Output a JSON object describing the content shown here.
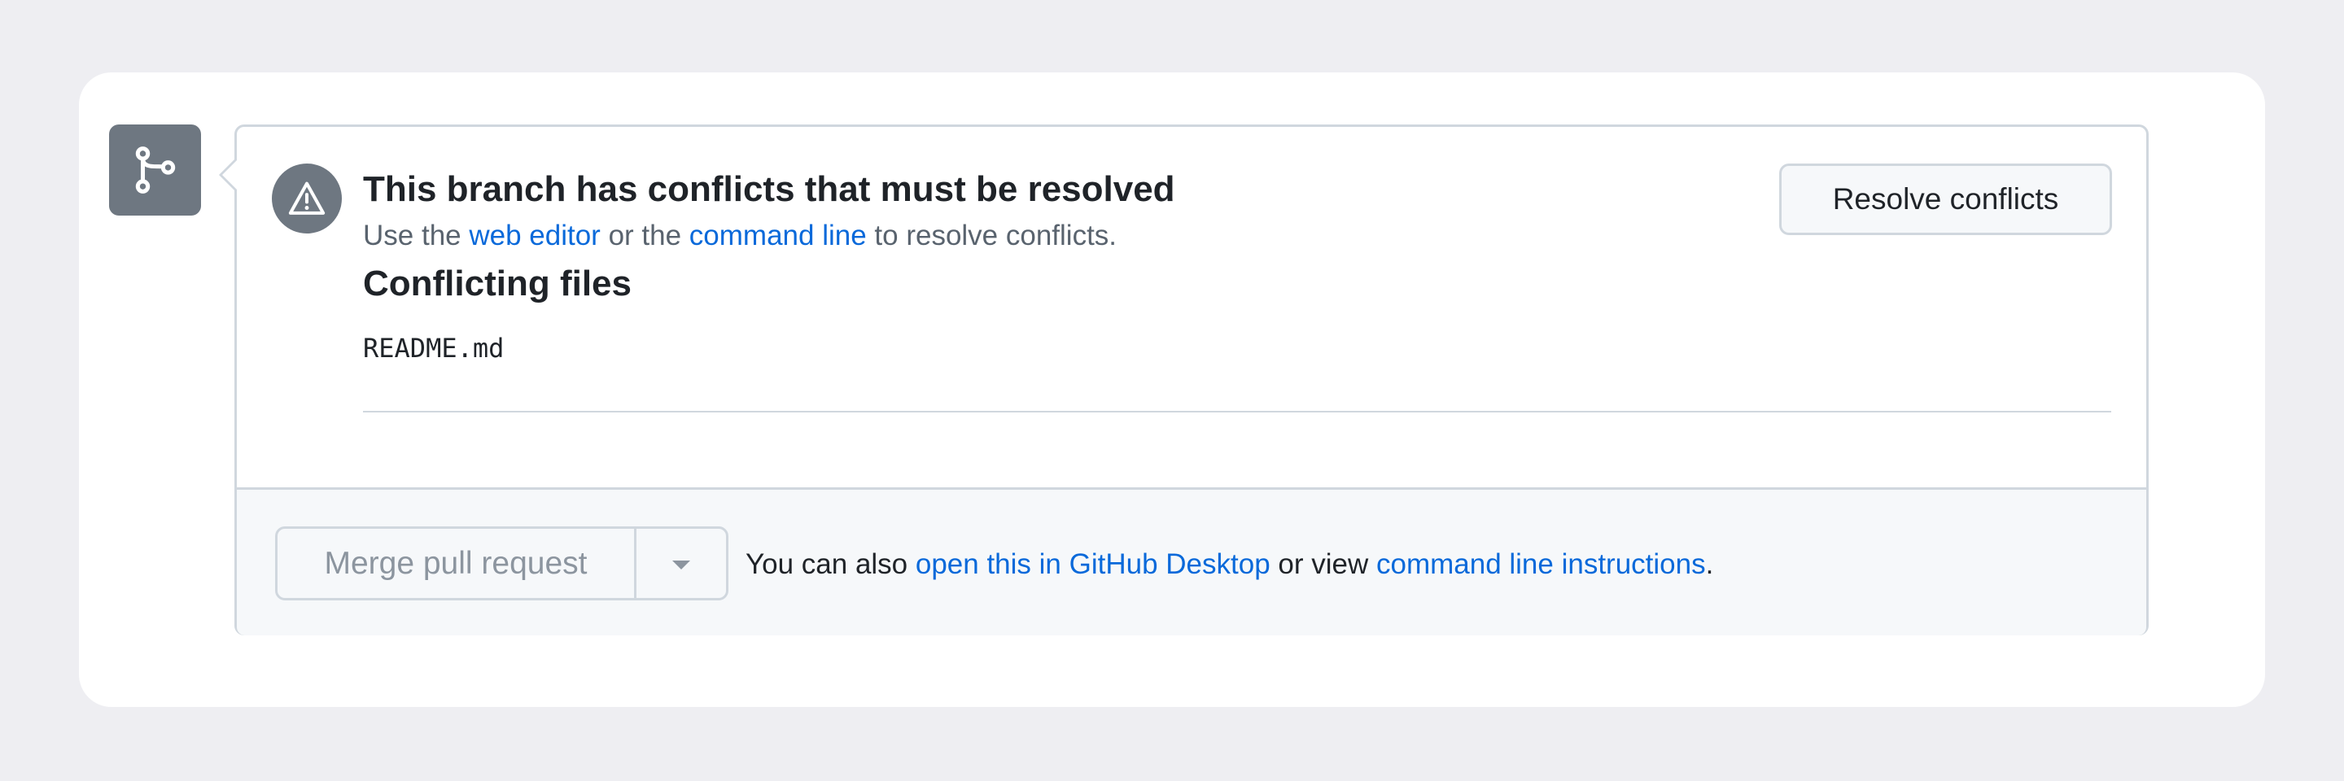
{
  "icons": {
    "merge_icon": "git-branch-icon",
    "warning_icon": "alert-icon",
    "caret_icon": "triangle-down-icon"
  },
  "colors": {
    "link": "#0969da",
    "muted_text": "#59636e",
    "icon_bg": "#6e7781",
    "border": "#d0d7de",
    "disabled_text": "#8c959f"
  },
  "conflict": {
    "title": "This branch has conflicts that must be resolved",
    "subtitle_prefix": "Use the ",
    "web_editor_link": "web editor",
    "subtitle_middle": " or the ",
    "command_line_link": "command line",
    "subtitle_suffix": " to resolve conflicts.",
    "files_heading": "Conflicting files",
    "files": [
      "README.md"
    ],
    "resolve_button": "Resolve conflicts"
  },
  "footer": {
    "merge_button": "Merge pull request",
    "text_prefix": "You can also ",
    "desktop_link": "open this in GitHub Desktop",
    "text_middle": " or view ",
    "instructions_link": "command line instructions",
    "text_suffix": "."
  }
}
